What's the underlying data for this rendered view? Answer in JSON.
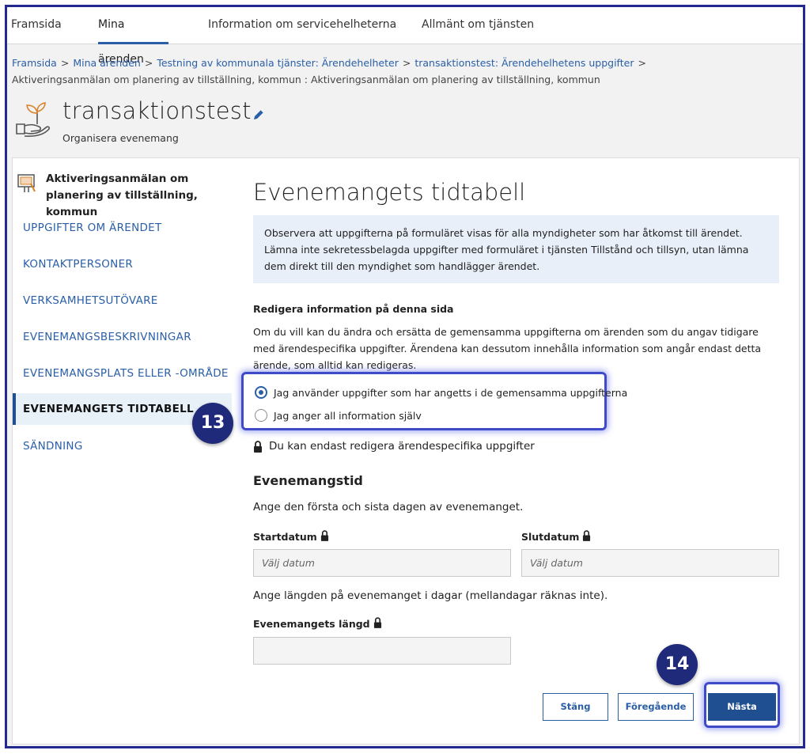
{
  "nav": {
    "tabs": [
      "Framsida",
      "Mina ärenden",
      "Information om servicehelheterna",
      "Allmänt om tjänsten"
    ],
    "active_index": 1
  },
  "breadcrumb": {
    "links": [
      "Framsida",
      "Mina ärenden",
      "Testning av kommunala tjänster: Ärendehelheter",
      "transaktionstest: Ärendehelhetens uppgifter"
    ],
    "current": "Aktiveringsanmälan om planering av tillställning, kommun : Aktiveringsanmälan om planering av tillställning, kommun",
    "separator": ">"
  },
  "header": {
    "title": "transaktionstest",
    "subtitle": "Organisera evenemang"
  },
  "sidebar": {
    "heading": "Aktiveringsanmälan om planering av tillställning, kommun",
    "items": [
      {
        "label": "UPPGIFTER OM ÄRENDET"
      },
      {
        "label": "KONTAKTPERSONER"
      },
      {
        "label": "VERKSAMHETSUTÖVARE"
      },
      {
        "label": "EVENEMANGSBESKRIVNINGAR"
      },
      {
        "label": "EVENEMANGSPLATS ELLER -OMRÅDE"
      },
      {
        "label": "EVENEMANGETS TIDTABELL"
      },
      {
        "label": "SÄNDNING"
      }
    ],
    "active_index": 5
  },
  "badges": {
    "step13": "13",
    "step14": "14"
  },
  "main": {
    "title": "Evenemangets tidtabell",
    "notice": "Observera att uppgifterna på formuläret visas för alla myndigheter som har åtkomst till ärendet. Lämna inte sekretessbelagda uppgifter med formuläret i tjänsten Tillstånd och tillsyn, utan lämna dem direkt till den myndighet som handlägger ärendet.",
    "edit_heading": "Redigera information på denna sida",
    "edit_text": "Om du vill kan du ändra och ersätta de gemensamma uppgifterna om ärenden som du angav tidigare med ärendespecifika uppgifter. Ärendena kan dessutom innehålla information som angår endast detta ärende, som alltid kan redigeras.",
    "radio_options": [
      {
        "label": "Jag använder uppgifter som har angetts i de gemensamma uppgifterna",
        "checked": true
      },
      {
        "label": "Jag anger all information själv",
        "checked": false
      }
    ],
    "lock_note": "Du kan endast redigera ärendespecifika uppgifter",
    "section_title": "Evenemangstid",
    "section_help": "Ange den första och sista dagen av evenemanget.",
    "start_label": "Startdatum",
    "end_label": "Slutdatum",
    "date_placeholder": "Välj datum",
    "length_help": "Ange längden på evenemanget i dagar (mellandagar räknas inte).",
    "length_label": "Evenemangets längd",
    "length_value": ""
  },
  "buttons": {
    "close": "Stäng",
    "previous": "Föregående",
    "next": "Nästa"
  },
  "colors": {
    "accent": "#2a5fa7",
    "primary": "#1f4f91",
    "badge": "#1f2a7a",
    "highlight": "#3f4ac9",
    "notice_bg": "#e8eff8"
  }
}
